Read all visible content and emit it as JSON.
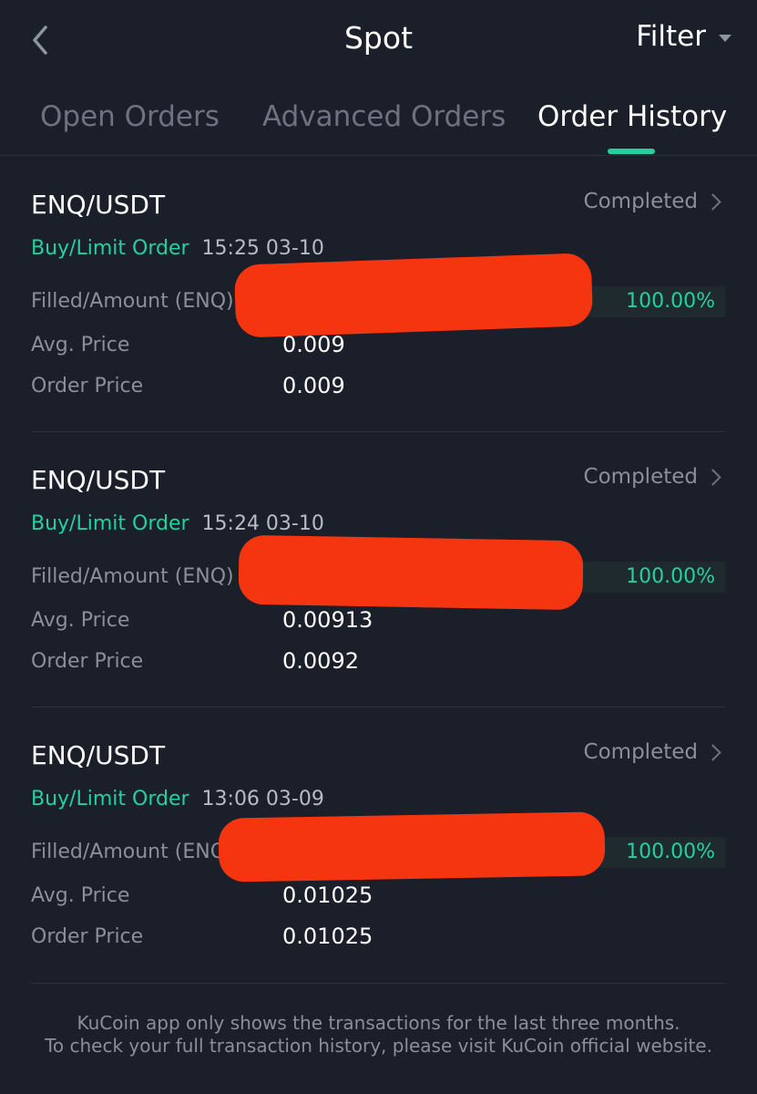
{
  "header": {
    "title": "Spot",
    "filter_label": "Filter"
  },
  "tabs": [
    {
      "label": "Open Orders",
      "active": false
    },
    {
      "label": "Advanced Orders",
      "active": false
    },
    {
      "label": "Order History",
      "active": true
    }
  ],
  "labels": {
    "filled_amount": "Filled/Amount (ENQ)",
    "avg_price": "Avg. Price",
    "order_price": "Order Price"
  },
  "orders": [
    {
      "pair": "ENQ/USDT",
      "status": "Completed",
      "type": "Buy/Limit Order",
      "time": "15:25 03-10",
      "fill_percent": "100.00%",
      "avg_price": "0.009",
      "order_price": "0.009"
    },
    {
      "pair": "ENQ/USDT",
      "status": "Completed",
      "type": "Buy/Limit Order",
      "time": "15:24 03-10",
      "fill_percent": "100.00%",
      "avg_price": "0.00913",
      "order_price": "0.0092"
    },
    {
      "pair": "ENQ/USDT",
      "status": "Completed",
      "type": "Buy/Limit Order",
      "time": "13:06 03-09",
      "fill_percent": "100.00%",
      "avg_price": "0.01025",
      "order_price": "0.01025"
    }
  ],
  "footer": {
    "line1": "KuCoin app only shows the transactions for the last three months.",
    "line2": "To check your full transaction history, please visit KuCoin official website."
  },
  "colors": {
    "background": "#1b1f2a",
    "accent_green": "#24d0a0",
    "muted_text": "#8a8f9b",
    "redaction": "#f5350f"
  },
  "icons": {
    "back": "chevron-left-icon",
    "filter_caret": "caret-down-icon",
    "status_arrow": "chevron-right-icon"
  }
}
